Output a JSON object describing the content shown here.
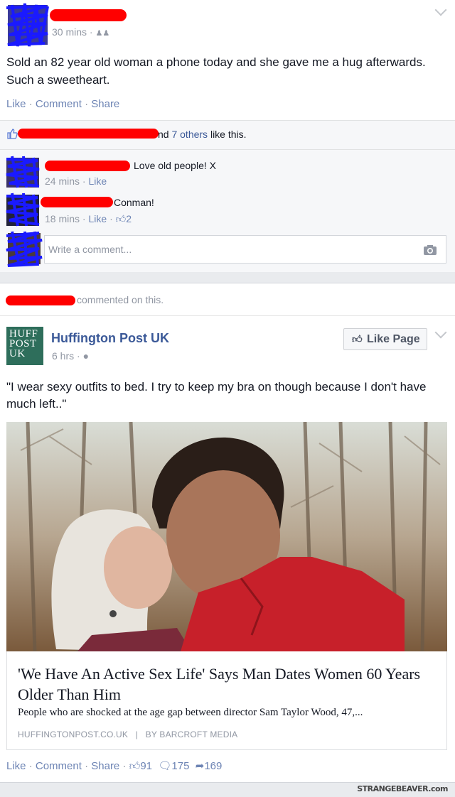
{
  "post1": {
    "time": "30 mins",
    "privacy_icon": "friends-icon",
    "text": "Sold an 82 year old woman a phone today and she gave me a hug afterwards. Such a sweetheart.",
    "actions": {
      "like": "Like",
      "comment": "Comment",
      "share": "Share",
      "dot": "·"
    },
    "likes_line": {
      "partial": "nd ",
      "others": "7 others",
      "suffix": " like this."
    },
    "comments": [
      {
        "text": "Love old people! X",
        "time": "24 mins",
        "like": "Like"
      },
      {
        "text": "Conman!",
        "time": "18 mins",
        "like": "Like",
        "like_count": "2"
      }
    ],
    "comment_input": {
      "placeholder": "Write a comment...",
      "camera_icon": "camera-icon"
    }
  },
  "post2": {
    "activity": "commented on this.",
    "page_name": "Huffington Post UK",
    "logo_text": [
      "HUFF",
      "POST",
      "UK"
    ],
    "time": "6 hrs",
    "globe_icon": "globe-icon",
    "like_page": "Like Page",
    "text": "\"I wear sexy outfits to bed. I try to keep my bra on though because I don't have much left..\"",
    "link": {
      "headline": "'We Have An Active Sex Life' Says Man Dates Women 60 Years Older Than Him",
      "description": "People who are shocked at the age gap between director Sam Taylor Wood, 47,...",
      "source": "HUFFINGTONPOST.CO.UK",
      "divider": "|",
      "byline": "BY BARCROFT MEDIA"
    },
    "actions": {
      "like": "Like",
      "comment": "Comment",
      "share": "Share",
      "dot": "·"
    },
    "counts": {
      "likes": "91",
      "comments": "175",
      "shares": "169"
    }
  },
  "watermark": "STRANGEBEAVER.com",
  "colors": {
    "redaction": "#ff0000",
    "scribble": "#1a1aff",
    "fb_blue": "#3b5998",
    "huff_green": "#2e6e5b"
  }
}
